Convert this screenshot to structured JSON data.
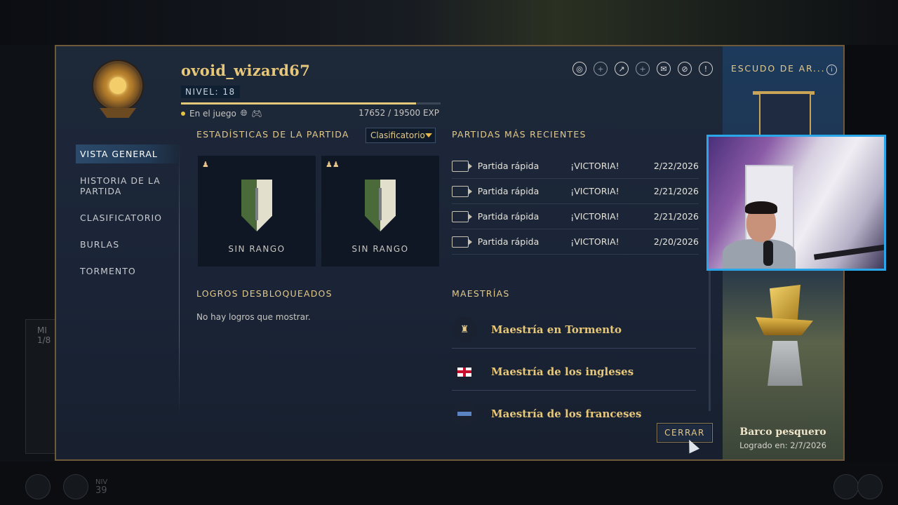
{
  "profile": {
    "username": "ovoid_wizard67",
    "level_label": "NIVEL: 18",
    "status_text": "En el juego",
    "xp_text": "17652 / 19500 EXP",
    "xp_progress": 0.905
  },
  "nav": {
    "items": [
      {
        "label": "VISTA GENERAL",
        "active": true
      },
      {
        "label": "HISTORIA DE LA PARTIDA",
        "active": false
      },
      {
        "label": "CLASIFICATORIO",
        "active": false
      },
      {
        "label": "BURLAS",
        "active": false
      },
      {
        "label": "TORMENTO",
        "active": false
      }
    ]
  },
  "stats": {
    "title": "ESTADÍSTICAS DE LA PARTIDA",
    "dropdown_value": "Clasificatorio",
    "ranks": [
      {
        "mode_icon": "single-player-icon",
        "label": "SIN RANGO"
      },
      {
        "mode_icon": "team-icon",
        "label": "SIN RANGO"
      }
    ]
  },
  "recent": {
    "title": "PARTIDAS MÁS RECIENTES",
    "rows": [
      {
        "mode": "Partida rápida",
        "result": "¡VICTORIA!",
        "date": "2/22/2026"
      },
      {
        "mode": "Partida rápida",
        "result": "¡VICTORIA!",
        "date": "2/21/2026"
      },
      {
        "mode": "Partida rápida",
        "result": "¡VICTORIA!",
        "date": "2/21/2026"
      },
      {
        "mode": "Partida rápida",
        "result": "¡VICTORIA!",
        "date": "2/20/2026"
      }
    ]
  },
  "achievements": {
    "title": "LOGROS DESBLOQUEADOS",
    "empty_text": "No hay logros que mostrar."
  },
  "masteries": {
    "title": "MAESTRÍAS",
    "items": [
      {
        "label": "Maestría en Tormento",
        "icon": "torment-icon"
      },
      {
        "label": "Maestría de los ingleses",
        "icon": "england-flag-icon"
      },
      {
        "label": "Maestría de los franceses",
        "icon": "france-flag-icon"
      }
    ]
  },
  "close_label": "CERRAR",
  "coat_of_arms": {
    "title": "ESCUDO DE AR...",
    "item_name": "Barco pesquero",
    "achieved_text": "Logrado en: 2/7/2026"
  },
  "background": {
    "ghost_label_1": "MI",
    "ghost_label_2": "1/8",
    "bottom_label": "NIV",
    "bottom_value": "39"
  },
  "colors": {
    "accent_gold": "#e3c98a",
    "panel_bg": "#1a2436",
    "active_nav": "#2c4a6b",
    "webcam_border": "#2aa7e8"
  }
}
